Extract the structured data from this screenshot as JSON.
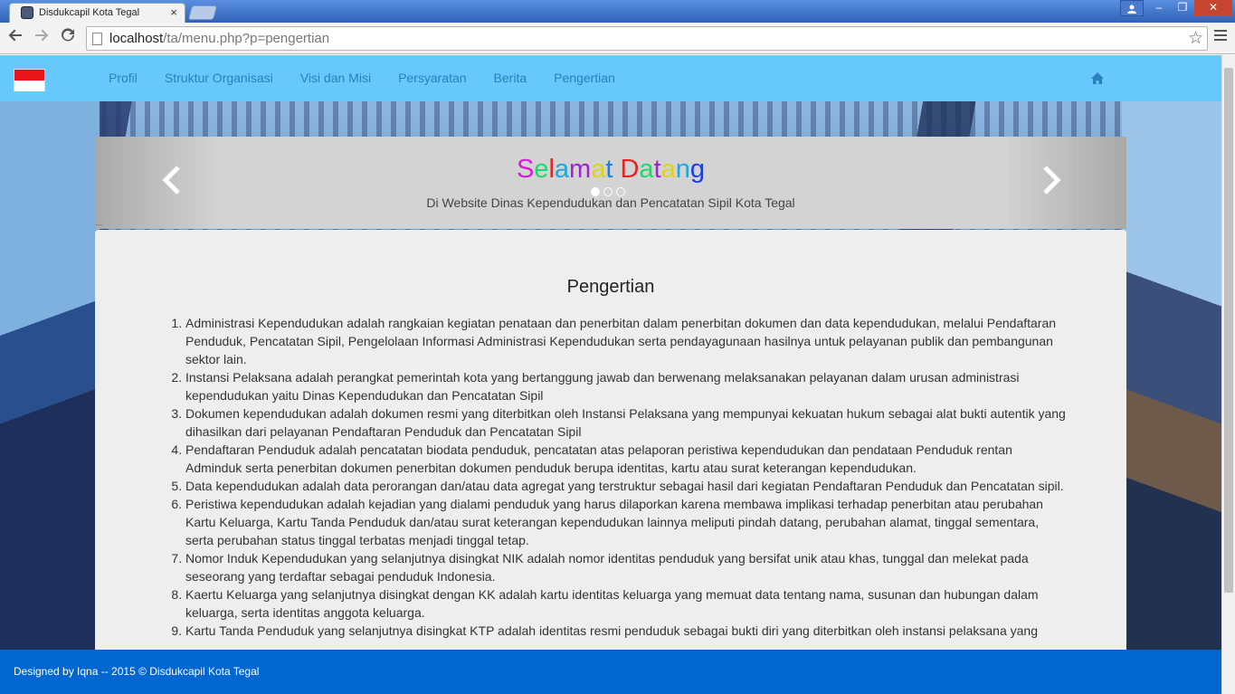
{
  "browser": {
    "tab_title": "Disdukcapil Kota Tegal",
    "tab_close": "×",
    "url_host": "localhost",
    "url_path": "/ta/menu.php?p=pengertian",
    "window_buttons": {
      "min": "–",
      "max": "❐",
      "close": "✕"
    }
  },
  "navbar": {
    "links": [
      "Profil",
      "Struktur Organisasi",
      "Visi dan Misi",
      "Persyaratan",
      "Berita",
      "Pengertian"
    ]
  },
  "carousel": {
    "heading_letters": [
      {
        "ch": "S",
        "color": "#d61bd8"
      },
      {
        "ch": "e",
        "color": "#1bd86a"
      },
      {
        "ch": "l",
        "color": "#e02525"
      },
      {
        "ch": "a",
        "color": "#1ba8e0"
      },
      {
        "ch": "m",
        "color": "#a020d8"
      },
      {
        "ch": "a",
        "color": "#e0d21b"
      },
      {
        "ch": "t",
        "color": "#1b7ee0"
      },
      {
        "ch": " ",
        "color": "#000000"
      },
      {
        "ch": "D",
        "color": "#e02525"
      },
      {
        "ch": "a",
        "color": "#1bd86a"
      },
      {
        "ch": "t",
        "color": "#a020d8"
      },
      {
        "ch": "a",
        "color": "#e0d21b"
      },
      {
        "ch": "n",
        "color": "#1ba8e0"
      },
      {
        "ch": "g",
        "color": "#1b3ee0"
      }
    ],
    "subtitle": "Di Website Dinas Kependudukan dan Pencatatan Sipil Kota Tegal",
    "prev": "‹",
    "next": "›",
    "dots": "..."
  },
  "content": {
    "title": "Pengertian",
    "items": [
      "Administrasi Kependudukan adalah rangkaian kegiatan penataan dan penerbitan dalam penerbitan dokumen dan data kependudukan, melalui Pendaftaran Penduduk, Pencatatan Sipil, Pengelolaan Informasi Administrasi Kependudukan serta pendayagunaan hasilnya untuk pelayanan publik dan pembangunan sektor lain.",
      "Instansi Pelaksana adalah perangkat pemerintah kota yang bertanggung jawab dan berwenang melaksanakan pelayanan dalam urusan administrasi kependudukan yaitu Dinas Kependudukan dan Pencatatan Sipil",
      "Dokumen kependudukan adalah dokumen resmi yang diterbitkan oleh Instansi Pelaksana yang mempunyai kekuatan hukum sebagai alat bukti autentik yang dihasilkan dari pelayanan Pendaftaran Penduduk dan Pencatatan Sipil",
      "Pendaftaran Penduduk adalah pencatatan biodata penduduk, pencatatan atas pelaporan peristiwa kependudukan dan pendataan Penduduk rentan Adminduk serta penerbitan dokumen penerbitan dokumen penduduk berupa identitas, kartu atau surat keterangan kependudukan.",
      "Data kependudukan adalah data perorangan dan/atau data agregat yang terstruktur sebagai hasil dari kegiatan Pendaftaran Penduduk dan Pencatatan sipil.",
      "Peristiwa kependudukan adalah kejadian yang dialami penduduk yang harus dilaporkan karena membawa implikasi terhadap penerbitan atau perubahan Kartu Keluarga, Kartu Tanda Penduduk dan/atau surat keterangan kependudukan lainnya meliputi pindah datang, perubahan alamat, tinggal sementara, serta perubahan status tinggal terbatas menjadi tinggal tetap.",
      "Nomor Induk Kependudukan yang selanjutnya disingkat NIK adalah nomor identitas penduduk yang bersifat unik atau khas, tunggal dan melekat pada seseorang yang terdaftar sebagai penduduk Indonesia.",
      "Kaertu Keluarga yang selanjutnya disingkat dengan KK adalah kartu identitas keluarga yang memuat data tentang nama, susunan dan hubungan dalam keluarga, serta identitas anggota keluarga.",
      "Kartu Tanda Penduduk yang selanjutnya disingkat KTP adalah identitas resmi penduduk sebagai bukti diri yang diterbitkan oleh instansi pelaksana yang"
    ]
  },
  "footer": {
    "text": "Designed by Iqna -- 2015 © Disdukcapil Kota Tegal"
  }
}
